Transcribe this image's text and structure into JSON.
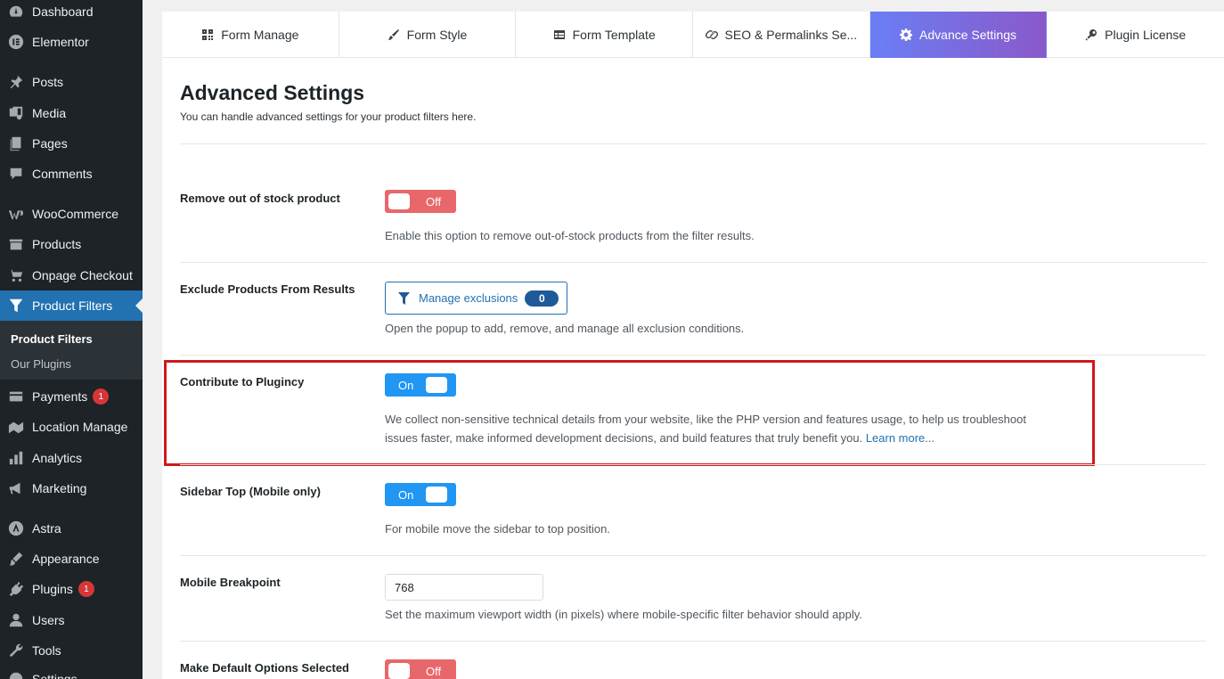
{
  "sidebar": {
    "items": [
      {
        "label": "Dashboard",
        "icon": "dashboard-icon"
      },
      {
        "label": "Elementor",
        "icon": "elementor-icon"
      },
      {
        "label": "Posts",
        "icon": "pin-icon"
      },
      {
        "label": "Media",
        "icon": "media-icon"
      },
      {
        "label": "Pages",
        "icon": "pages-icon"
      },
      {
        "label": "Comments",
        "icon": "comment-icon"
      },
      {
        "label": "WooCommerce",
        "icon": "woocommerce-icon"
      },
      {
        "label": "Products",
        "icon": "products-icon"
      },
      {
        "label": "Onpage Checkout",
        "icon": "cart-icon"
      },
      {
        "label": "Product Filters",
        "icon": "filter-icon"
      },
      {
        "label": "Payments",
        "icon": "payments-icon",
        "badge": "1"
      },
      {
        "label": "Location Manage",
        "icon": "location-icon"
      },
      {
        "label": "Analytics",
        "icon": "analytics-icon"
      },
      {
        "label": "Marketing",
        "icon": "megaphone-icon"
      },
      {
        "label": "Astra",
        "icon": "astra-icon"
      },
      {
        "label": "Appearance",
        "icon": "brush-icon"
      },
      {
        "label": "Plugins",
        "icon": "plugin-icon",
        "badge": "1"
      },
      {
        "label": "Users",
        "icon": "user-icon"
      },
      {
        "label": "Tools",
        "icon": "wrench-icon"
      },
      {
        "label": "Settings",
        "icon": "settings-icon"
      }
    ],
    "submenu": [
      "Product Filters",
      "Our Plugins"
    ]
  },
  "tabs": [
    {
      "label": "Form Manage",
      "icon": "form-manage-icon"
    },
    {
      "label": "Form Style",
      "icon": "brush-icon"
    },
    {
      "label": "Form Template",
      "icon": "template-icon"
    },
    {
      "label": "SEO & Permalinks Se...",
      "icon": "link-icon"
    },
    {
      "label": "Advance Settings",
      "icon": "gear-icon"
    },
    {
      "label": "Plugin License",
      "icon": "key-icon"
    }
  ],
  "page": {
    "title": "Advanced Settings",
    "subtitle": "You can handle advanced settings for your product filters here."
  },
  "settings": {
    "remove_out_of_stock": {
      "label": "Remove out of stock product",
      "toggle": "Off",
      "desc": "Enable this option to remove out-of-stock products from the filter results."
    },
    "exclude_products": {
      "label": "Exclude Products From Results",
      "button": "Manage exclusions",
      "count": "0",
      "desc": "Open the popup to add, remove, and manage all exclusion conditions."
    },
    "contribute": {
      "label": "Contribute to Plugincy",
      "toggle": "On",
      "desc_line1": "We collect non-sensitive technical details from your website, like the PHP version and features usage, to help us troubleshoot",
      "desc_line2": "issues faster, make informed development decisions, and build features that truly benefit you.",
      "link": "Learn more..."
    },
    "sidebar_top": {
      "label": "Sidebar Top (Mobile only)",
      "toggle": "On",
      "desc": "For mobile move the sidebar to top position."
    },
    "mobile_breakpoint": {
      "label": "Mobile Breakpoint",
      "value": "768",
      "desc": "Set the maximum viewport width (in pixels) where mobile-specific filter behavior should apply."
    },
    "default_options": {
      "label": "Make Default Options Selected",
      "toggle": "Off"
    }
  },
  "colors": {
    "admin_bar": "#1d2327",
    "active_menu": "#2271b1",
    "toggle_on": "#2196f3",
    "toggle_off": "#e8676b",
    "highlight": "#d0191c"
  }
}
